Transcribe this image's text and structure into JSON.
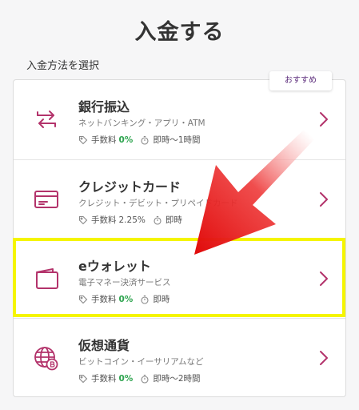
{
  "page": {
    "title": "入金する"
  },
  "section": {
    "label": "入金方法を選択"
  },
  "badge": {
    "label": "おすすめ"
  },
  "methods": [
    {
      "title": "銀行振込",
      "subtitle": "ネットバンキング・アプリ・ATM",
      "fee_label": "手数料",
      "fee_value": "0%",
      "time": "即時〜1時間",
      "icon": "bank-transfer-icon"
    },
    {
      "title": "クレジットカード",
      "subtitle": "クレジット・デビット・プリペイドカード",
      "fee_label": "手数料",
      "fee_value": "2.25%",
      "time": "即時",
      "icon": "credit-card-icon"
    },
    {
      "title": "eウォレット",
      "subtitle": "電子マネー決済サービス",
      "fee_label": "手数料",
      "fee_value": "0%",
      "time": "即時",
      "icon": "wallet-icon"
    },
    {
      "title": "仮想通貨",
      "subtitle": "ビットコイン・イーサリアムなど",
      "fee_label": "手数料",
      "fee_value": "0%",
      "time": "即時〜2時間",
      "icon": "crypto-globe-icon"
    }
  ],
  "colors": {
    "accent": "#b3336b",
    "free_fee": "#2ea44f",
    "highlight": "#f5f500",
    "arrow": "#e01010"
  }
}
